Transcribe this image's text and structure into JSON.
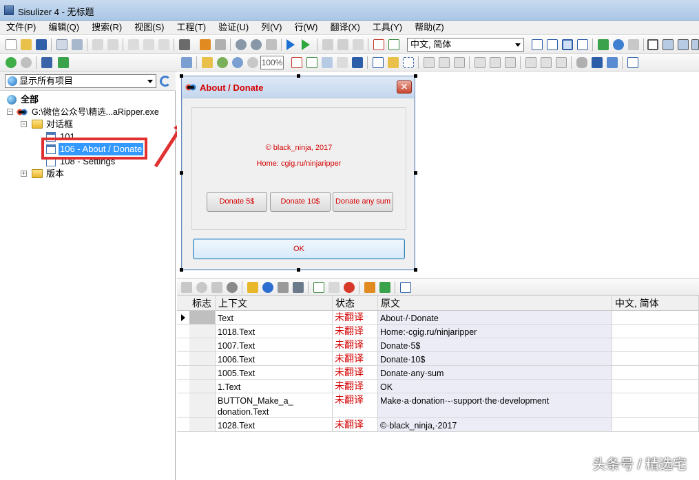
{
  "window": {
    "title": "Sisulizer 4 - 无标题"
  },
  "menu": [
    "文件(P)",
    "编辑(Q)",
    "搜索(R)",
    "视图(S)",
    "工程(T)",
    "验证(U)",
    "列(V)",
    "行(W)",
    "翻译(X)",
    "工具(Y)",
    "帮助(Z)"
  ],
  "toolbar": {
    "language_select": "中文, 简体",
    "zoom_value": "100%"
  },
  "left": {
    "filter": "显示所有项目",
    "tree": {
      "root": "全部",
      "exe": "G:\\微信公众号\\精选...aRipper.exe",
      "dialogs_folder": "对话框",
      "item_101": "101",
      "item_106": "106 - About / Donate",
      "item_108": "108 - Settings",
      "version_folder": "版本"
    }
  },
  "dialog": {
    "title": "About / Donate",
    "copyright": "© black_ninja, 2017",
    "home": "Home: cgig.ru/ninjaripper",
    "btn_5": "Donate 5$",
    "btn_10": "Donate 10$",
    "btn_any": "Donate any sum",
    "btn_ok": "OK"
  },
  "grid": {
    "headers": {
      "flag": "标志",
      "context": "上下文",
      "status": "状态",
      "original": "原文",
      "target": "中文, 简体"
    },
    "rows": [
      {
        "context": "Text",
        "status": "未翻译",
        "original": "About·/·Donate"
      },
      {
        "context": "1018.Text",
        "status": "未翻译",
        "original": "Home:·cgig.ru/ninjaripper"
      },
      {
        "context": "1007.Text",
        "status": "未翻译",
        "original": "Donate·5$"
      },
      {
        "context": "1006.Text",
        "status": "未翻译",
        "original": "Donate·10$"
      },
      {
        "context": "1005.Text",
        "status": "未翻译",
        "original": "Donate·any·sum"
      },
      {
        "context": "1.Text",
        "status": "未翻译",
        "original": "OK"
      },
      {
        "context": "BUTTON_Make_a_ donation.Text",
        "status": "未翻译",
        "original": "Make·a·donation·-·support·the·development"
      },
      {
        "context": "1028.Text",
        "status": "未翻译",
        "original": "©·black_ninja,·2017"
      }
    ]
  },
  "watermark": "头条号 / 精选宅"
}
